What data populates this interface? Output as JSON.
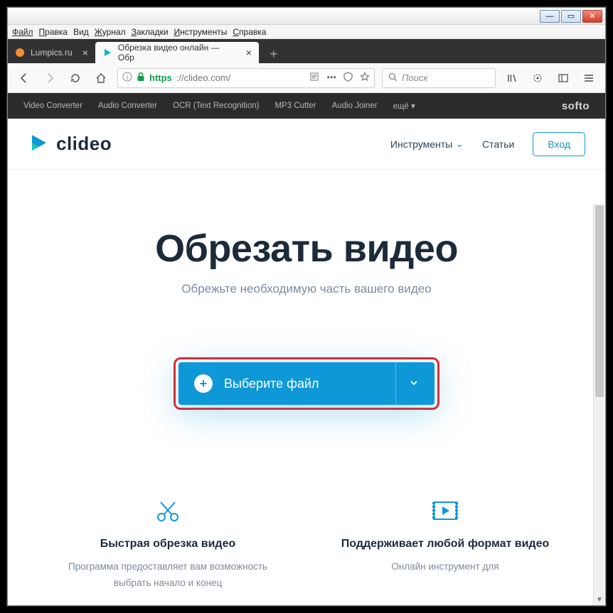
{
  "menubar": [
    "Файл",
    "Правка",
    "Вид",
    "Журнал",
    "Закладки",
    "Инструменты",
    "Справка"
  ],
  "tabs": [
    {
      "title": "Lumpics.ru",
      "active": false,
      "icon": "orange"
    },
    {
      "title": "Обрезка видео онлайн — Обр",
      "active": true,
      "icon": "play"
    }
  ],
  "addressbar": {
    "scheme": "https",
    "host": "://clideo.com/"
  },
  "search_placeholder": "Поиск",
  "top_strip": [
    "Video Converter",
    "Audio Converter",
    "OCR (Text Recognition)",
    "MP3 Cutter",
    "Audio Joiner",
    "ещё ▾"
  ],
  "top_brand": "softo",
  "site": {
    "logo_text": "clideo",
    "nav_tools": "Инструменты",
    "nav_articles": "Статьи",
    "login": "Вход"
  },
  "hero": {
    "title": "Обрезать видео",
    "subtitle": "Обрежьте необходимую часть вашего видео"
  },
  "cta": "Выберите файл",
  "features": [
    {
      "title": "Быстрая обрезка видео",
      "desc": "Программа предоставляет вам возможность выбрать начало и конец"
    },
    {
      "title": "Поддерживает любой формат видео",
      "desc": "Онлайн инструмент для"
    }
  ]
}
